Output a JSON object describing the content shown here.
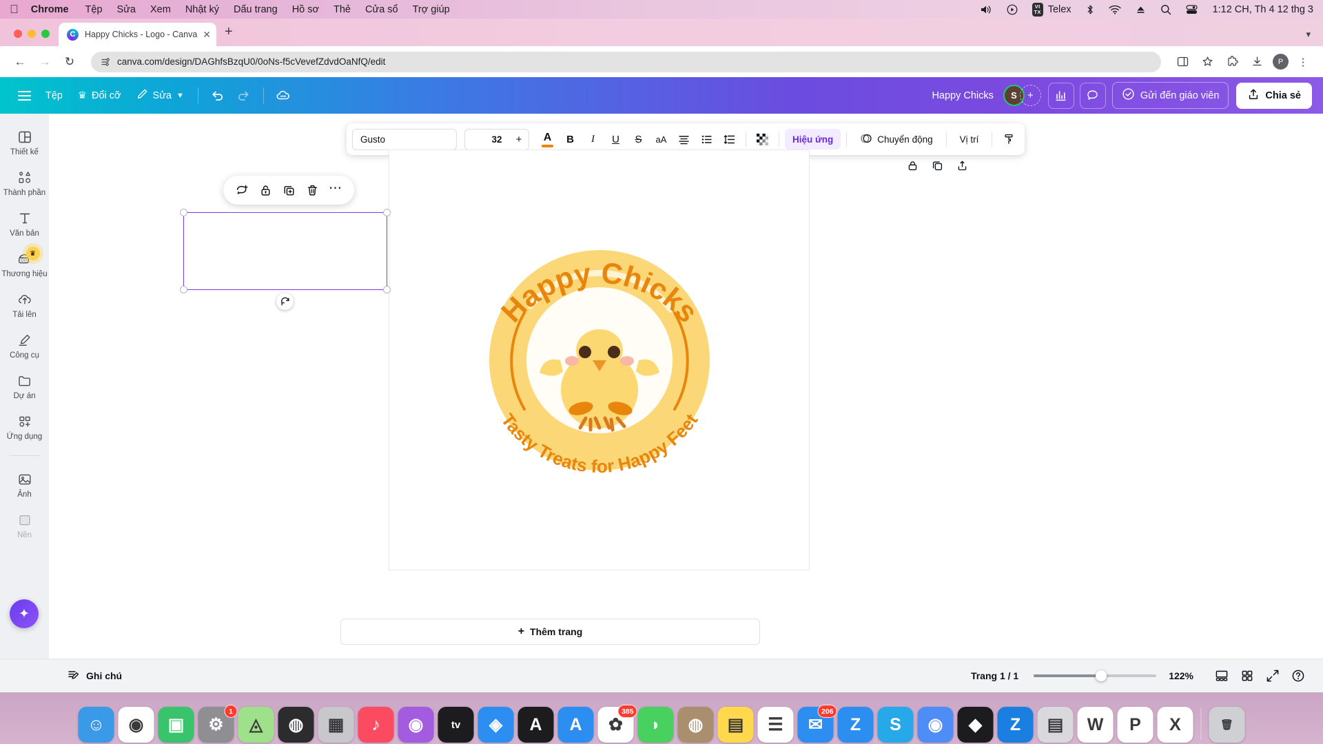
{
  "macbar": {
    "apple_icon": "apple-icon",
    "menus": [
      "Chrome",
      "Tệp",
      "Sửa",
      "Xem",
      "Nhật ký",
      "Dấu trang",
      "Hồ sơ",
      "Thẻ",
      "Cửa sổ",
      "Trợ giúp"
    ],
    "status_icons": [
      "volume-icon",
      "play-circle-icon",
      "telex-indicator",
      "bluetooth-icon",
      "wifi-icon",
      "eject-icon",
      "search-icon",
      "control-center-icon"
    ],
    "telex_label": "Telex",
    "telex_badge_top": "VI",
    "telex_badge_bottom": "TX",
    "clock": "1:12 CH, Th 4 12 thg 3"
  },
  "chrome": {
    "traffic_lights": [
      "#ff5f57",
      "#febc2e",
      "#28c840"
    ],
    "tab": {
      "title": "Happy Chicks - Logo - Canva",
      "favicon_letter": "C",
      "close_icon": "close-icon"
    },
    "new_tab_icon": "plus-icon",
    "tab_list_chevron": "chevron-down-icon",
    "nav": {
      "back_icon": "back-arrow-icon",
      "forward_icon": "forward-arrow-icon",
      "reload_icon": "reload-icon"
    },
    "url": "canva.com/design/DAGhfsBzqU0/0oNs-f5cVevefZdvdOaNfQ/edit",
    "site_info_icon": "site-settings-icon",
    "right_icons": [
      "split-view-icon",
      "bookmark-star-icon",
      "extensions-icon",
      "download-icon"
    ],
    "profile_letter": "P",
    "menu_icon": "three-dot-menu-icon"
  },
  "canva_header": {
    "menu_icon": "hamburger-icon",
    "file_label": "Tệp",
    "resize_label": "Đổi cỡ",
    "resize_icon": "crown-icon",
    "edit_label": "Sửa",
    "edit_icon": "pencil-icon",
    "edit_chevron": "chevron-down-icon",
    "undo_icon": "undo-icon",
    "redo_icon": "redo-icon",
    "cloud_icon": "cloud-saved-icon",
    "doc_name": "Happy Chicks",
    "avatar_letter": "S",
    "add_member_icon": "plus-icon",
    "insights_icon": "bar-chart-icon",
    "comment_icon": "comment-bubble-icon",
    "send_teacher_label": "Gửi đến giáo viên",
    "send_teacher_icon": "check-circle-icon",
    "share_label": "Chia sẻ",
    "share_icon": "share-upload-icon"
  },
  "rail": {
    "items": [
      {
        "label": "Thiết kế",
        "icon": "layout-panels-icon",
        "muted": false,
        "pro": false
      },
      {
        "label": "Thành phần",
        "icon": "shapes-icon",
        "muted": false,
        "pro": false
      },
      {
        "label": "Văn bản",
        "icon": "text-T-icon",
        "muted": false,
        "pro": false
      },
      {
        "label": "Thương hiệu",
        "icon": "brand-kit-icon",
        "muted": false,
        "pro": true
      },
      {
        "label": "Tải lên",
        "icon": "upload-cloud-icon",
        "muted": false,
        "pro": false
      },
      {
        "label": "Công cụ",
        "icon": "draw-pen-icon",
        "muted": false,
        "pro": false
      },
      {
        "label": "Dự án",
        "icon": "folder-icon",
        "muted": false,
        "pro": false
      },
      {
        "label": "Ứng dụng",
        "icon": "apps-grid-icon",
        "muted": false,
        "pro": false
      }
    ],
    "items_after_sep": [
      {
        "label": "Ảnh",
        "icon": "photo-icon",
        "muted": false,
        "pro": false
      },
      {
        "label": "Nền",
        "icon": "background-pattern-icon",
        "muted": true,
        "pro": false
      }
    ],
    "magic_icon": "magic-sparkle-icon"
  },
  "text_toolbar": {
    "font_family": "Gusto",
    "font_size": "32",
    "decrease_icon": "minus-icon",
    "increase_icon": "plus-icon",
    "text_color_letter": "A",
    "text_color_hex": "#e8850c",
    "bold_label": "B",
    "italic_label": "I",
    "underline_label": "U",
    "strike_label": "S",
    "case_label": "aA",
    "align_icon": "align-icon",
    "list_icon": "bullet-list-icon",
    "spacing_icon": "line-spacing-icon",
    "transparency_icon": "transparency-checker-icon",
    "effects_label": "Hiệu ứng",
    "animate_label": "Chuyển động",
    "animate_icon": "animate-circles-icon",
    "position_label": "Vị trí",
    "more_icon": "copy-style-icon"
  },
  "page_tools": {
    "lock_icon": "lock-icon",
    "duplicate_icon": "duplicate-icon",
    "export_icon": "export-icon"
  },
  "element_toolbar": {
    "comment_icon": "add-comment-icon",
    "lock_icon": "unlock-icon",
    "duplicate_icon": "duplicate-page-icon",
    "delete_icon": "trash-icon",
    "more_icon": "more-dots-icon"
  },
  "canvas": {
    "logo": {
      "outer_ring_color": "#fbd778",
      "arc_color": "#e8850c",
      "title_text": "Happy Chicks",
      "tagline_text": "Tasty Treats for Happy Feet",
      "chick_body_color": "#fcd873",
      "chick_beak_color": "#f0922a",
      "chick_cheek_color": "#f9b7a8"
    },
    "rotate_icon": "rotate-handle-icon",
    "selected_element": "Happy Chicks"
  },
  "add_page": {
    "label": "Thêm trang",
    "icon": "plus-icon"
  },
  "bottom_bar": {
    "notes_label": "Ghi chú",
    "notes_icon": "notes-icon",
    "page_count": "Trang 1 / 1",
    "zoom_value": "122%",
    "zoom_percent": 55,
    "timeline_icon": "timeline-view-icon",
    "grid_icon": "grid-view-icon",
    "fullscreen_icon": "fullscreen-icon",
    "help_icon": "help-circle-icon"
  },
  "dock": {
    "items": [
      {
        "name": "finder",
        "glyph": "☺",
        "color": "#3a9ae8",
        "badge": null
      },
      {
        "name": "chrome",
        "glyph": "◉",
        "color": "#ffffff",
        "badge": null
      },
      {
        "name": "facetime",
        "glyph": "▣",
        "color": "#39c46b",
        "badge": null
      },
      {
        "name": "system-settings",
        "glyph": "⚙",
        "color": "#8e8e93",
        "badge": "1"
      },
      {
        "name": "maps",
        "glyph": "◬",
        "color": "#9fe08a",
        "badge": null
      },
      {
        "name": "siri",
        "glyph": "◍",
        "color": "#2c2c2e",
        "badge": null
      },
      {
        "name": "launchpad",
        "glyph": "▦",
        "color": "#c8c8cc",
        "badge": null
      },
      {
        "name": "music",
        "glyph": "♪",
        "color": "#fa4b61",
        "badge": null
      },
      {
        "name": "podcasts",
        "glyph": "◉",
        "color": "#a35ce0",
        "badge": null
      },
      {
        "name": "apple-tv",
        "glyph": "tv",
        "color": "#1c1c1e",
        "badge": null
      },
      {
        "name": "safari",
        "glyph": "◈",
        "color": "#2b8ef0",
        "badge": null
      },
      {
        "name": "app-a",
        "glyph": "A",
        "color": "#1c1c1e",
        "badge": null
      },
      {
        "name": "app-store",
        "glyph": "A",
        "color": "#2b8ef0",
        "badge": null
      },
      {
        "name": "photos",
        "glyph": "✿",
        "color": "#ffffff",
        "badge": "385"
      },
      {
        "name": "messages",
        "glyph": "◗",
        "color": "#48d15e",
        "badge": null
      },
      {
        "name": "contacts",
        "glyph": "◍",
        "color": "#a98f6e",
        "badge": null
      },
      {
        "name": "notes",
        "glyph": "▤",
        "color": "#ffd84d",
        "badge": null
      },
      {
        "name": "reminders",
        "glyph": "☰",
        "color": "#ffffff",
        "badge": null
      },
      {
        "name": "mail",
        "glyph": "✉",
        "color": "#2b8ef0",
        "badge": "206"
      },
      {
        "name": "zalo",
        "glyph": "Z",
        "color": "#2b8ef0",
        "badge": null
      },
      {
        "name": "skype",
        "glyph": "S",
        "color": "#26a8e9",
        "badge": null
      },
      {
        "name": "messenger",
        "glyph": "◉",
        "color": "#4d8df5",
        "badge": null
      },
      {
        "name": "capcut",
        "glyph": "◆",
        "color": "#1c1c1e",
        "badge": null
      },
      {
        "name": "zalo-pc",
        "glyph": "Z",
        "color": "#1a7fe0",
        "badge": null
      },
      {
        "name": "dictionary",
        "glyph": "▤",
        "color": "#d9d9dd",
        "badge": null
      },
      {
        "name": "word",
        "glyph": "W",
        "color": "#ffffff",
        "badge": null
      },
      {
        "name": "powerpoint",
        "glyph": "P",
        "color": "#ffffff",
        "badge": null
      },
      {
        "name": "excel",
        "glyph": "X",
        "color": "#ffffff",
        "badge": null
      },
      {
        "name": "trash",
        "glyph": "🗑",
        "color": "#cfd0d4",
        "badge": null
      }
    ]
  }
}
